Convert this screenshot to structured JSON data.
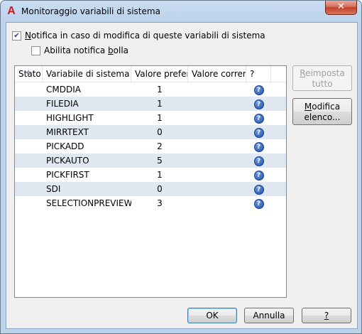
{
  "window": {
    "title": "Monitoraggio variabili di sistema",
    "close_label": "✕"
  },
  "options": {
    "notify_checked": true,
    "notify_label_first": "N",
    "notify_label_rest": "otifica in caso di modifica di queste variabili di sistema",
    "balloon_checked": false,
    "balloon_label_pre": "Abilita notifica ",
    "balloon_label_access": "b",
    "balloon_label_post": "olla"
  },
  "table": {
    "columns": [
      "Stato",
      "Variabile di sistema",
      "Valore preferi",
      "Valore corren",
      "?"
    ],
    "rows": [
      {
        "stato": "",
        "variable": "CMDDIA",
        "preferred": "1",
        "current": ""
      },
      {
        "stato": "",
        "variable": "FILEDIA",
        "preferred": "1",
        "current": ""
      },
      {
        "stato": "",
        "variable": "HIGHLIGHT",
        "preferred": "1",
        "current": ""
      },
      {
        "stato": "",
        "variable": "MIRRTEXT",
        "preferred": "0",
        "current": ""
      },
      {
        "stato": "",
        "variable": "PICKADD",
        "preferred": "2",
        "current": ""
      },
      {
        "stato": "",
        "variable": "PICKAUTO",
        "preferred": "5",
        "current": ""
      },
      {
        "stato": "",
        "variable": "PICKFIRST",
        "preferred": "1",
        "current": ""
      },
      {
        "stato": "",
        "variable": "SDI",
        "preferred": "0",
        "current": ""
      },
      {
        "stato": "",
        "variable": "SELECTIONPREVIEW",
        "preferred": "3",
        "current": ""
      }
    ],
    "help_icon": "help-question-icon"
  },
  "side_buttons": {
    "reset_access": "R",
    "reset_rest_line1": "eimposta",
    "reset_line2": "tutto",
    "edit_access": "M",
    "edit_rest_line1": "odifica",
    "edit_line2": "elenco..."
  },
  "footer": {
    "ok_label": "OK",
    "cancel_label": "Annulla",
    "help_label": "?"
  },
  "colors": {
    "alt_row": "#e0e8f1",
    "help_icon": "#1f4ea8",
    "app_icon": "#cc1d1d",
    "close_button": "#c0412b"
  }
}
